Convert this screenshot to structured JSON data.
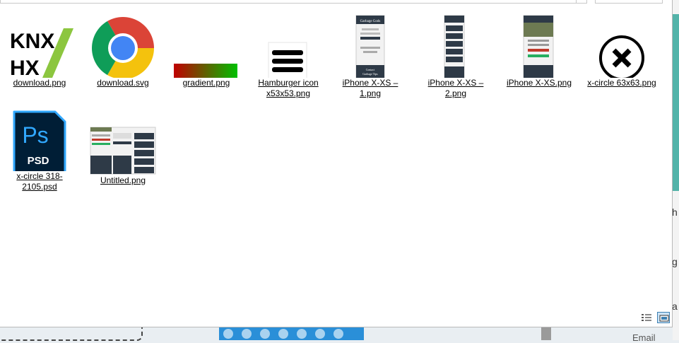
{
  "files": [
    {
      "name": "download.png",
      "icon": "knx-logo-image"
    },
    {
      "name": "download.svg",
      "icon": "chrome-logo-image"
    },
    {
      "name": "gradient.png",
      "icon": "gradient-image"
    },
    {
      "name": "Hamburger icon x53x53.png",
      "icon": "hamburger-menu-image"
    },
    {
      "name": "iPhone X-XS – 1.png",
      "icon": "phone-mockup-image"
    },
    {
      "name": "iPhone X-XS – 2.png",
      "icon": "phone-mockup-image"
    },
    {
      "name": "iPhone X-XS.png",
      "icon": "phone-mockup-image"
    },
    {
      "name": "x-circle 63x63.png",
      "icon": "x-circle-image"
    },
    {
      "name": "x-circle 318-2105.psd",
      "icon": "photoshop-psd-icon"
    },
    {
      "name": "Untitled.png",
      "icon": "site-mockup-image"
    }
  ],
  "thumbs": {
    "knx_line1": "KNX",
    "knx_line2": "HX",
    "psd_badge_top": "Ps",
    "psd_badge_bottom": "PSD",
    "phone_title": "Garbage Gods",
    "phone_footer_label": "Contact",
    "phone_footer_name": "Garbage Tips"
  },
  "colors": {
    "gradient_start": "#c00000",
    "gradient_end": "#00c000",
    "chrome_red": "#db4437",
    "chrome_yellow": "#f4c20d",
    "chrome_green": "#0f9d58",
    "chrome_blue": "#4285f4",
    "psd_bg": "#001e36",
    "psd_border": "#31a8ff",
    "knx_green": "#8cc63f",
    "background_teal": "#53b3a9"
  },
  "background": {
    "side_letters": [
      "h",
      "g",
      "a"
    ],
    "email_label": "Email"
  },
  "view_buttons": {
    "details": "details-view-icon",
    "large_icons": "large-icons-view-icon"
  }
}
